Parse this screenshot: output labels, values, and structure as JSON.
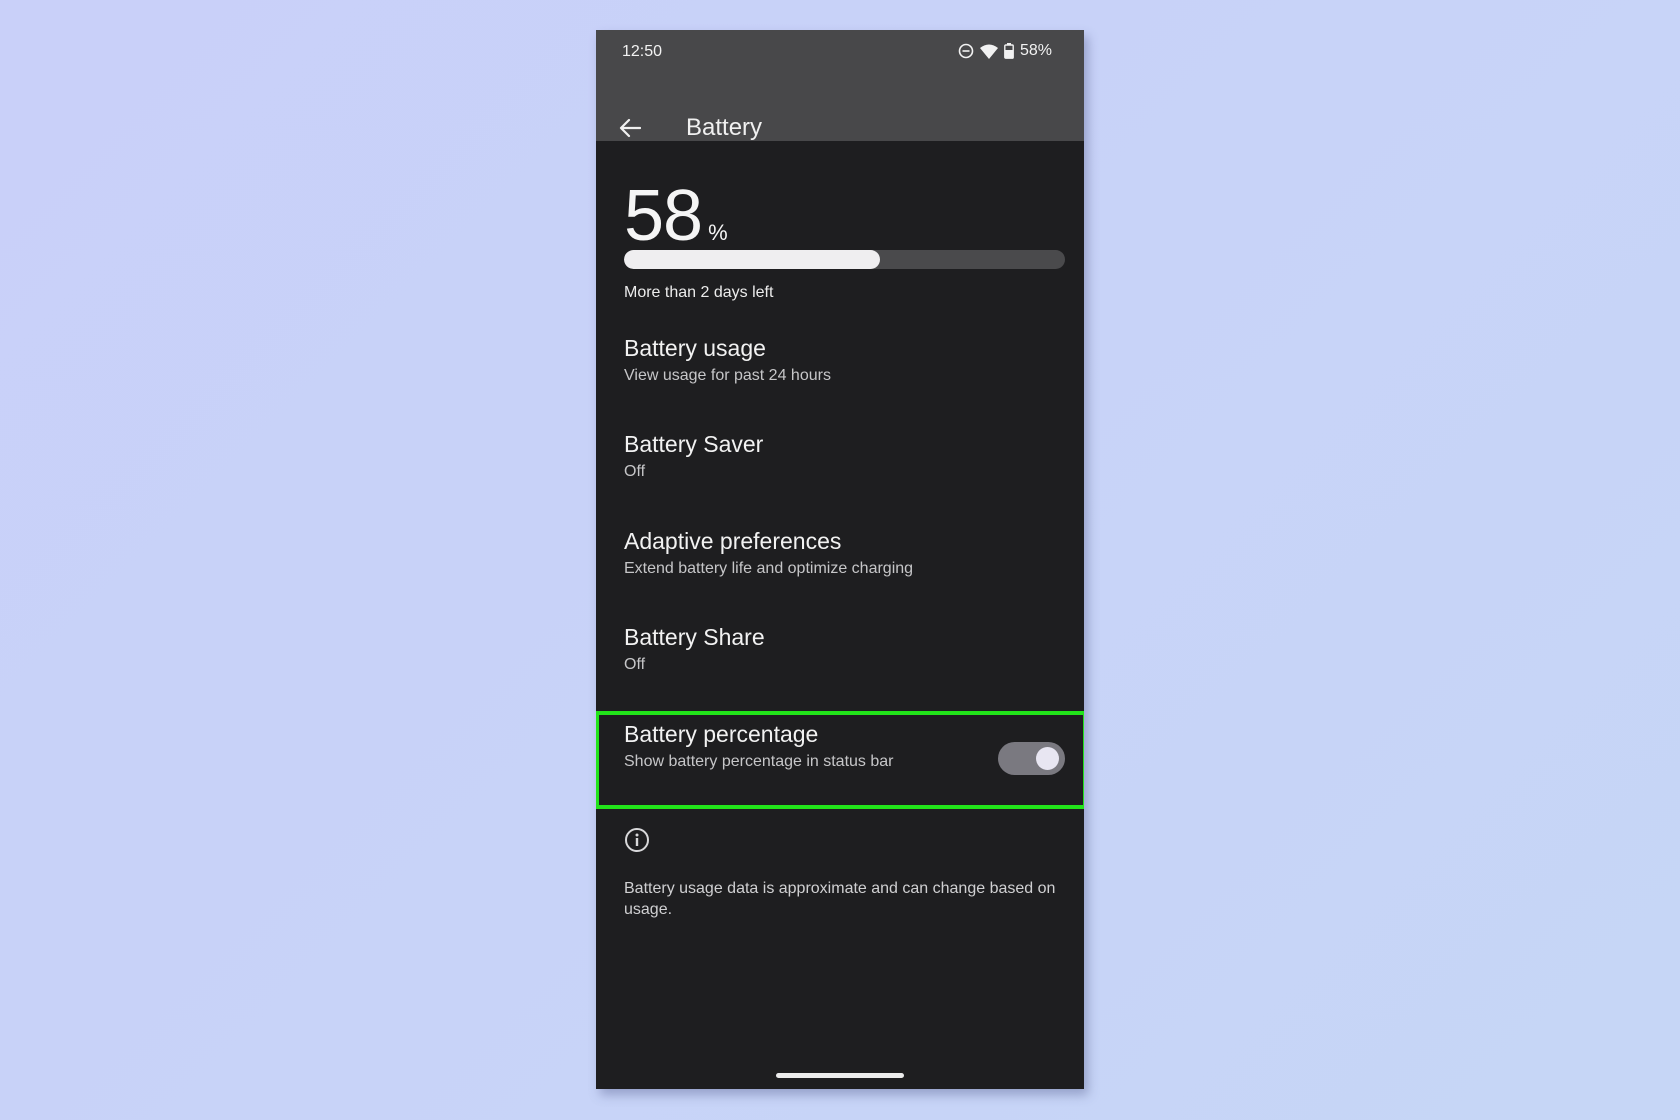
{
  "status_bar": {
    "time": "12:50",
    "icons": [
      "do-not-disturb-icon",
      "wifi-icon",
      "battery-icon"
    ],
    "battery_text": "58%"
  },
  "header": {
    "back_icon": "arrow-left-icon",
    "title": "Battery"
  },
  "battery": {
    "level_value": "58",
    "level_sign": "%",
    "level_fraction": 0.58,
    "time_left": "More than 2 days left"
  },
  "settings": [
    {
      "title": "Battery usage",
      "subtitle": "View usage for past 24 hours"
    },
    {
      "title": "Battery Saver",
      "subtitle": "Off"
    },
    {
      "title": "Adaptive preferences",
      "subtitle": "Extend battery life and optimize charging"
    },
    {
      "title": "Battery Share",
      "subtitle": "Off"
    },
    {
      "title": "Battery percentage",
      "subtitle": "Show battery percentage in status bar",
      "toggle": true,
      "highlighted": true
    }
  ],
  "footer": {
    "icon": "info-icon",
    "text": "Battery usage data is approximate and can change based on usage."
  },
  "colors": {
    "highlight": "#22e41a",
    "background": "#c8d2f8",
    "topbar": "#48484a",
    "content": "#1e1e20"
  }
}
